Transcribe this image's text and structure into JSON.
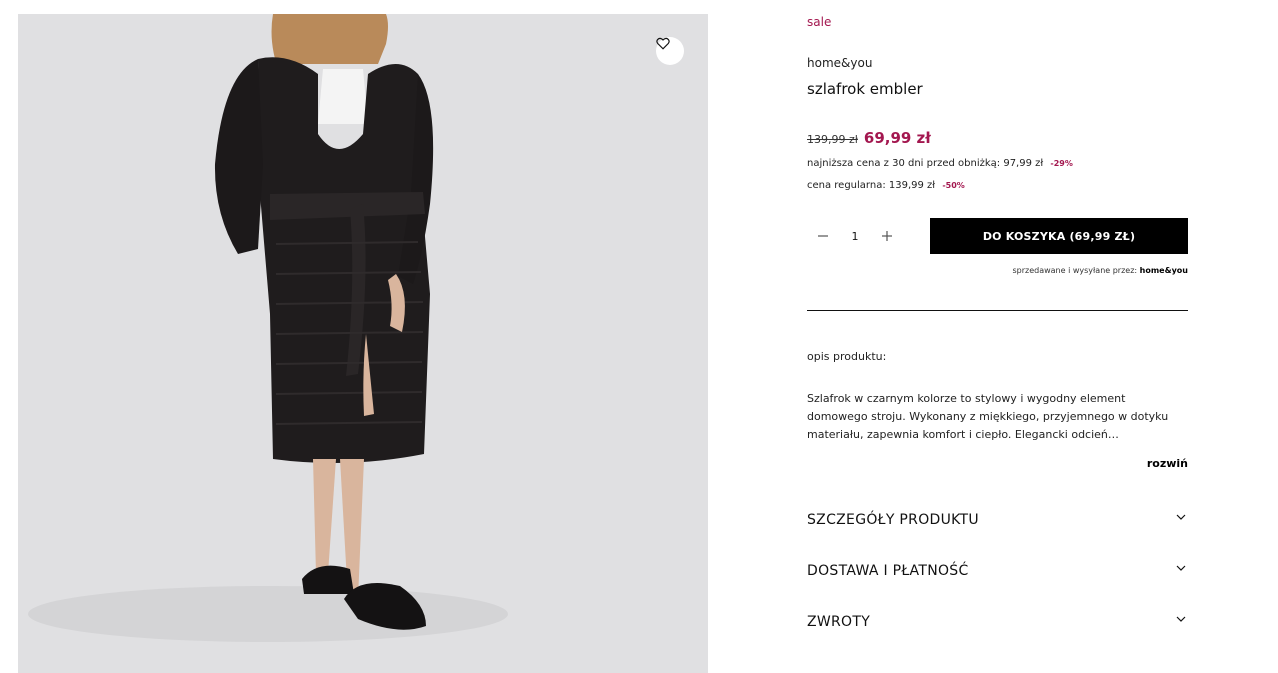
{
  "product": {
    "sale_label": "sale",
    "brand": "home&you",
    "name": "szlafrok embler",
    "old_price": "139,99 zł",
    "new_price": "69,99 zł",
    "lowest_price_text": "najniższa cena z 30 dni przed obniżką: 97,99 zł",
    "lowest_discount": "-29%",
    "regular_price_text": "cena regularna: 139,99 zł",
    "regular_discount": "-50%"
  },
  "purchase": {
    "quantity": "1",
    "minus_icon": "minus-icon",
    "plus_icon": "plus-icon",
    "cart_button": "DO KOSZYKA  (69,99 ZŁ)",
    "seller_prefix": "sprzedawane i wysyłane przez: ",
    "seller_name": "home&you"
  },
  "description": {
    "title": "opis produktu:",
    "text": "Szlafrok w czarnym kolorze to stylowy i wygodny element domowego stroju. Wykonany z miękkiego, przyjemnego w dotyku materiału, zapewnia komfort i ciepło. Elegancki odcień…",
    "expand_label": "rozwiń"
  },
  "accordion": [
    {
      "label": "SZCZEGÓŁY PRODUKTU"
    },
    {
      "label": "DOSTAWA I PŁATNOŚĆ"
    },
    {
      "label": "ZWROTY"
    }
  ],
  "icons": {
    "wishlist": "heart-icon",
    "chevron": "chevron-down-icon"
  },
  "colors": {
    "accent": "#a3174f",
    "button": "#000000",
    "image_background": "#e0e0e2"
  }
}
